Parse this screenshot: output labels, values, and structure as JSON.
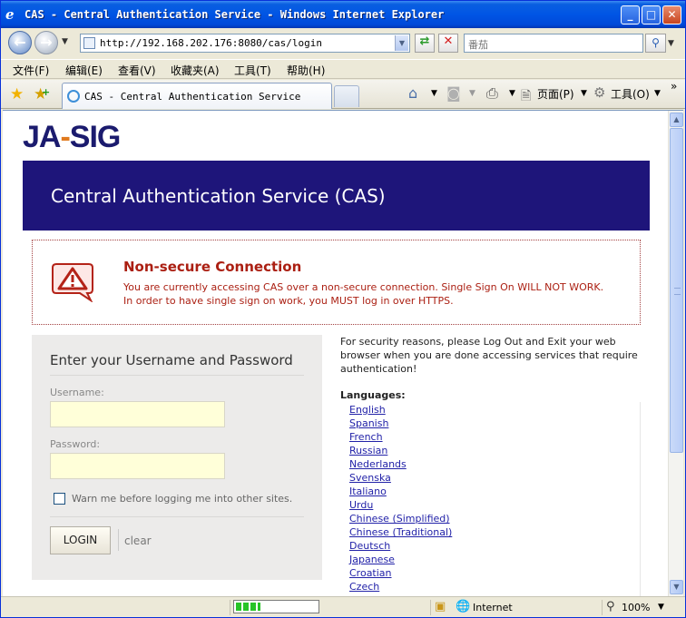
{
  "window": {
    "title": "CAS - Central Authentication Service - Windows Internet Explorer"
  },
  "address_bar": {
    "url": "http://192.168.202.176:8080/cas/login",
    "search_placeholder": "番茄"
  },
  "menu": [
    "文件(F)",
    "编辑(E)",
    "查看(V)",
    "收藏夹(A)",
    "工具(T)",
    "帮助(H)"
  ],
  "tab": {
    "title": "CAS - Central Authentication Service"
  },
  "command_bar": {
    "page_label": "页面(P)",
    "tools_label": "工具(O)"
  },
  "page": {
    "logo": "JASIG",
    "banner_title": "Central Authentication Service (CAS)",
    "warning": {
      "title": "Non-secure Connection",
      "body": "You are currently accessing CAS over a non-secure connection. Single Sign On WILL NOT WORK. In order to have single sign on work, you MUST log in over HTTPS."
    },
    "login": {
      "heading": "Enter your Username and Password",
      "username_label": "Username:",
      "username_value": "",
      "password_label": "Password:",
      "password_value": "",
      "warn_label": "Warn me before logging me into other sites.",
      "warn_checked": false,
      "login_button": "LOGIN",
      "clear_link": "clear"
    },
    "sidebar": {
      "security_note": "For security reasons, please Log Out and Exit your web browser when you are done accessing services that require authentication!",
      "languages_heading": "Languages:",
      "languages": [
        "English",
        "Spanish",
        "French",
        "Russian",
        "Nederlands",
        "Svenska",
        "Italiano",
        "Urdu",
        "Chinese (Simplified)",
        "Chinese (Traditional)",
        "Deutsch",
        "Japanese",
        "Croatian",
        "Czech"
      ]
    }
  },
  "status_bar": {
    "zone": "Internet",
    "zoom": "100%",
    "progress": 0.3
  },
  "colors": {
    "banner": "#1e157a",
    "warning_text": "#ab1f12",
    "link": "#2222a8",
    "input_bg": "#ffffd9"
  }
}
